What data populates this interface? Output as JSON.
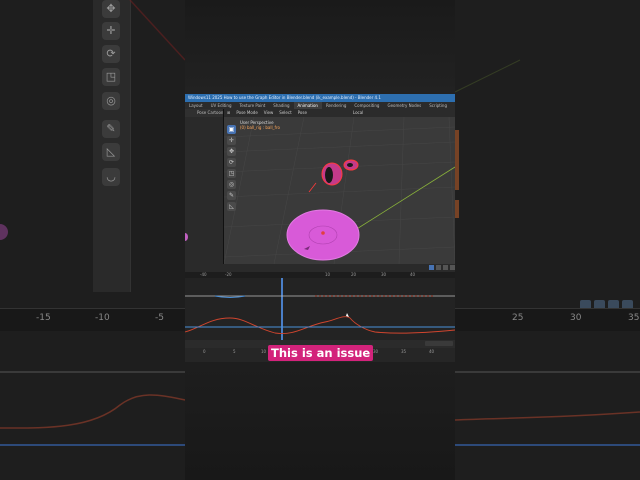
{
  "caption": "This is an issue",
  "window_title": "Windows11 2025 How to use the Graph Editor in Blender.blend (ik_example.blend) - Blender 4.1",
  "workspace_tabs": [
    {
      "label": "Layout",
      "active": false
    },
    {
      "label": "UV Editing",
      "active": false
    },
    {
      "label": "Texture Paint",
      "active": false
    },
    {
      "label": "Shading",
      "active": false
    },
    {
      "label": "Animation",
      "active": true
    },
    {
      "label": "Rendering",
      "active": false
    },
    {
      "label": "Compositing",
      "active": false
    },
    {
      "label": "Geometry Nodes",
      "active": false
    },
    {
      "label": "Scripting",
      "active": false
    },
    {
      "label": "+",
      "active": false
    }
  ],
  "left_panel_header": "Pose Cartoon",
  "viewport_header": {
    "mode": "Pose Mode",
    "menus": [
      "View",
      "Select",
      "Pose"
    ],
    "orientation": "Local"
  },
  "viewport_info": {
    "view": "User Perspective",
    "object": "(0) ball_rig : ball_fro"
  },
  "viewport_tools": [
    {
      "icon": "select-box-icon",
      "glyph": "▣",
      "active": true
    },
    {
      "icon": "cursor-icon",
      "glyph": "✛",
      "active": false
    },
    {
      "icon": "move-icon",
      "glyph": "✥",
      "active": false
    },
    {
      "icon": "rotate-icon",
      "glyph": "⟳",
      "active": false
    },
    {
      "icon": "scale-icon",
      "glyph": "◳",
      "active": false
    },
    {
      "icon": "transform-icon",
      "glyph": "◎",
      "active": false
    },
    {
      "icon": "annotate-icon",
      "glyph": "✎",
      "active": false
    },
    {
      "icon": "measure-icon",
      "glyph": "◺",
      "active": false
    }
  ],
  "graph_frame_numbers": [
    "-40",
    "-20",
    "10",
    "20",
    "30",
    "40"
  ],
  "timeline_frame_numbers": [
    "0",
    "5",
    "10",
    "15",
    "20",
    "25",
    "30",
    "35",
    "40"
  ],
  "background": {
    "ruler_numbers": [
      "-15",
      "-10",
      "-5",
      "25",
      "30",
      "35"
    ],
    "tool_icons": [
      "move-icon",
      "rotate-icon",
      "scale-icon",
      "transform-icon",
      "annotate-icon",
      "measure-icon",
      "cursor-icon"
    ]
  },
  "colors": {
    "caption_bg": "#d3237b",
    "title_bar": "#2d6fb0",
    "selected_object": "#d85ad8",
    "curve_red": "#d0452e",
    "curve_blue": "#4a90d9"
  }
}
